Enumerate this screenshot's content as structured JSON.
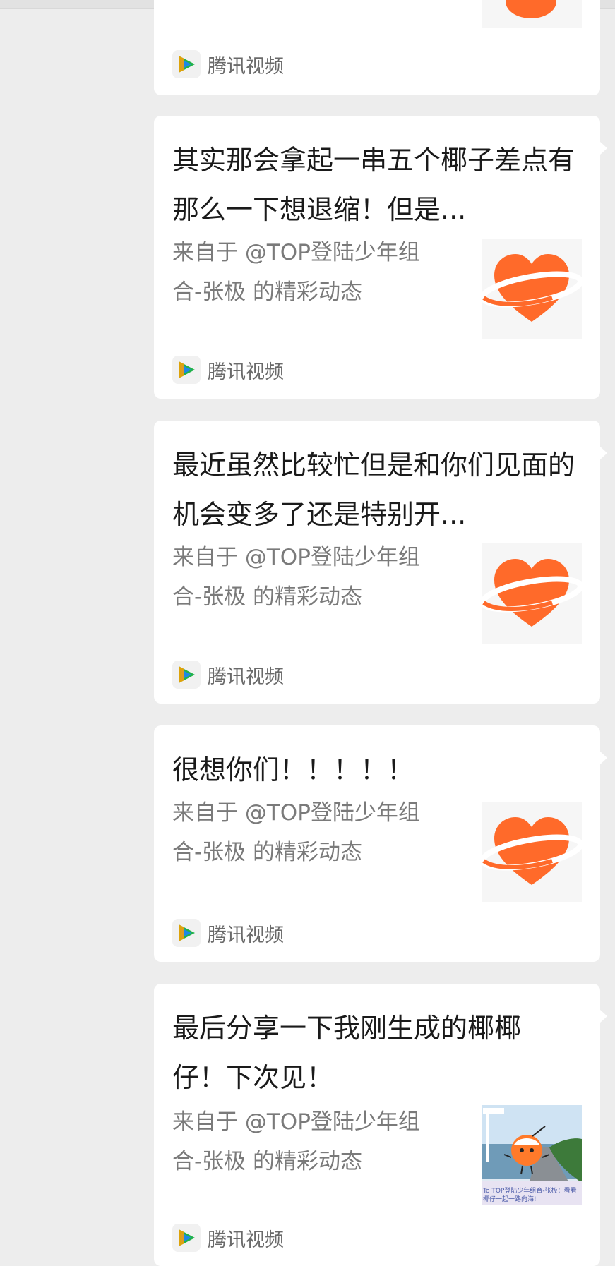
{
  "cards": [
    {
      "title": "",
      "source": "",
      "app_name": "腾讯视频",
      "thumb_icon": "heart-planet-icon"
    },
    {
      "title": "其实那会拿起一串五个椰子差点有那么一下想退缩！但是...",
      "source": "来自于 @TOP登陆少年组合-张极 的精彩动态",
      "app_name": "腾讯视频",
      "thumb_icon": "heart-planet-icon"
    },
    {
      "title": "最近虽然比较忙但是和你们见面的机会变多了还是特别开...",
      "source": "来自于 @TOP登陆少年组合-张极 的精彩动态",
      "app_name": "腾讯视频",
      "thumb_icon": "heart-planet-icon"
    },
    {
      "title": "很想你们！！！！！",
      "source": "来自于 @TOP登陆少年组合-张极 的精彩动态",
      "app_name": "腾讯视频",
      "thumb_icon": "heart-planet-icon"
    },
    {
      "title": "最后分享一下我刚生成的椰椰仔！下次见！",
      "source": "来自于 @TOP登陆少年组合-张极 的精彩动态",
      "app_name": "腾讯视频",
      "thumb_icon": "coconut-character-image",
      "thumb_caption": "To TOP登陆少年组合-张极：看看椰仔一起一路向海!"
    }
  ],
  "colors": {
    "background": "#ededed",
    "card": "#ffffff",
    "title_text": "#1a1a1a",
    "source_text": "#7a7a7a",
    "heart_orange": "#ff6a2a",
    "video_green": "#20b24a",
    "video_blue": "#1e88e5",
    "video_orange": "#ffa000"
  }
}
